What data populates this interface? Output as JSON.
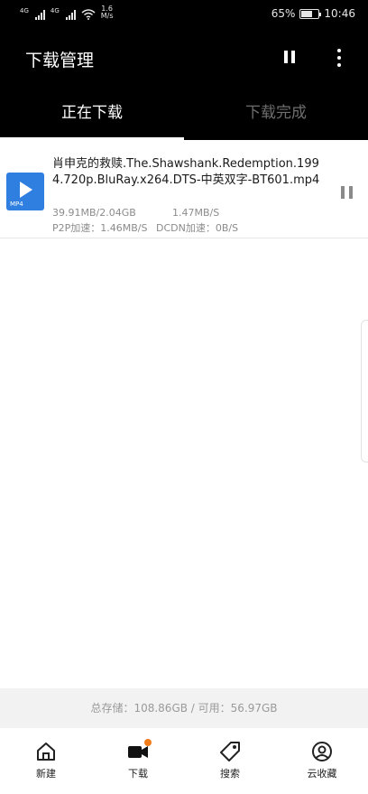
{
  "status_bar": {
    "signal1_label": "4G",
    "signal2_label": "4G",
    "net_speed_value": "1.6",
    "net_speed_unit": "M/s",
    "battery_percent": "65%",
    "time": "10:46"
  },
  "header": {
    "title": "下载管理",
    "icons": {
      "pause_all": "pause-icon",
      "more": "more-vertical-icon"
    }
  },
  "tabs": [
    {
      "label": "正在下载",
      "active": true
    },
    {
      "label": "下载完成",
      "active": false
    }
  ],
  "downloads": [
    {
      "filename": "肖申克的救赎.The.Shawshank.Redemption.1994.720p.BluRay.x264.DTS-中英双字-BT601.mp4",
      "file_type": "MP4",
      "progress": "39.91MB/2.04GB",
      "speed": "1.47MB/S",
      "p2p_speed": "P2P加速：1.46MB/S",
      "dcdn_speed": "DCDN加速：0B/S",
      "icon": "pause-icon"
    }
  ],
  "storage": {
    "text": "总存储：108.86GB / 可用：56.97GB"
  },
  "bottom_nav": [
    {
      "label": "新建",
      "icon": "home-icon"
    },
    {
      "label": "下载",
      "icon": "video-camera-icon",
      "active": true,
      "badge_color": "#f07c1a"
    },
    {
      "label": "搜索",
      "icon": "tag-icon"
    },
    {
      "label": "云收藏",
      "icon": "user-circle-icon"
    }
  ],
  "colors": {
    "header_bg": "#000000",
    "file_icon": "#2e7fe0",
    "badge": "#f07c1a",
    "storage_bg": "#f2f2f2"
  }
}
